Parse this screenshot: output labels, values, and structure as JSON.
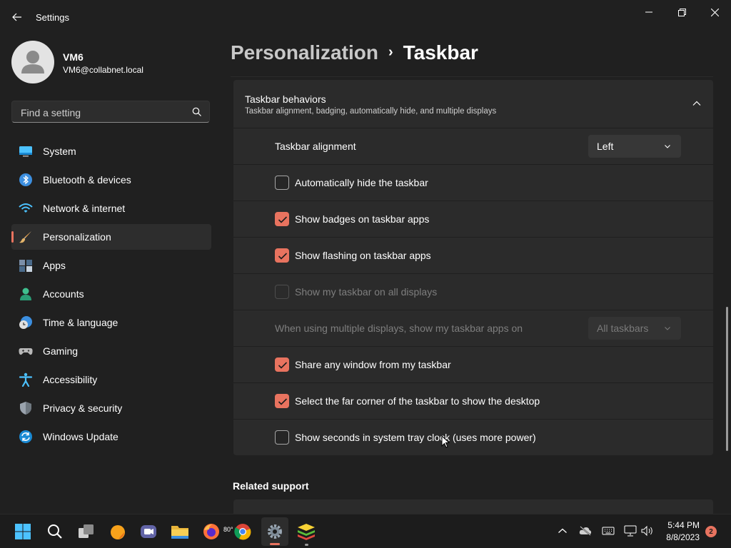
{
  "window": {
    "title": "Settings"
  },
  "user": {
    "name": "VM6",
    "email": "VM6@collabnet.local"
  },
  "search": {
    "placeholder": "Find a setting"
  },
  "nav": {
    "items": [
      {
        "label": "System",
        "icon": "system-icon"
      },
      {
        "label": "Bluetooth & devices",
        "icon": "bluetooth-icon"
      },
      {
        "label": "Network & internet",
        "icon": "wifi-icon"
      },
      {
        "label": "Personalization",
        "icon": "brush-icon",
        "active": true
      },
      {
        "label": "Apps",
        "icon": "apps-icon"
      },
      {
        "label": "Accounts",
        "icon": "accounts-icon"
      },
      {
        "label": "Time & language",
        "icon": "clock-globe-icon"
      },
      {
        "label": "Gaming",
        "icon": "gamepad-icon"
      },
      {
        "label": "Accessibility",
        "icon": "accessibility-icon"
      },
      {
        "label": "Privacy & security",
        "icon": "shield-icon"
      },
      {
        "label": "Windows Update",
        "icon": "update-icon"
      }
    ]
  },
  "breadcrumb": {
    "parent": "Personalization",
    "separator": "›",
    "current": "Taskbar"
  },
  "behaviors": {
    "title": "Taskbar behaviors",
    "subtitle": "Taskbar alignment, badging, automatically hide, and multiple displays",
    "alignment": {
      "label": "Taskbar alignment",
      "value": "Left"
    },
    "auto_hide": {
      "label": "Automatically hide the taskbar",
      "checked": false
    },
    "badges": {
      "label": "Show badges on taskbar apps",
      "checked": true
    },
    "flashing": {
      "label": "Show flashing on taskbar apps",
      "checked": true
    },
    "all_displays": {
      "label": "Show my taskbar on all displays",
      "checked": false,
      "disabled": true
    },
    "multi_display": {
      "label": "When using multiple displays, show my taskbar apps on",
      "value": "All taskbars",
      "disabled": true
    },
    "share_window": {
      "label": "Share any window from my taskbar",
      "checked": true
    },
    "far_corner": {
      "label": "Select the far corner of the taskbar to show the desktop",
      "checked": true
    },
    "show_seconds": {
      "label": "Show seconds in system tray clock (uses more power)",
      "checked": false
    }
  },
  "related": {
    "title": "Related support"
  },
  "taskbar": {
    "weather_temp": "80°",
    "clock_time": "5:44 PM",
    "clock_date": "8/8/2023",
    "notification_count": "2"
  },
  "colors": {
    "accent": "#e8735f",
    "background": "#202020",
    "card": "#2b2b2b"
  }
}
